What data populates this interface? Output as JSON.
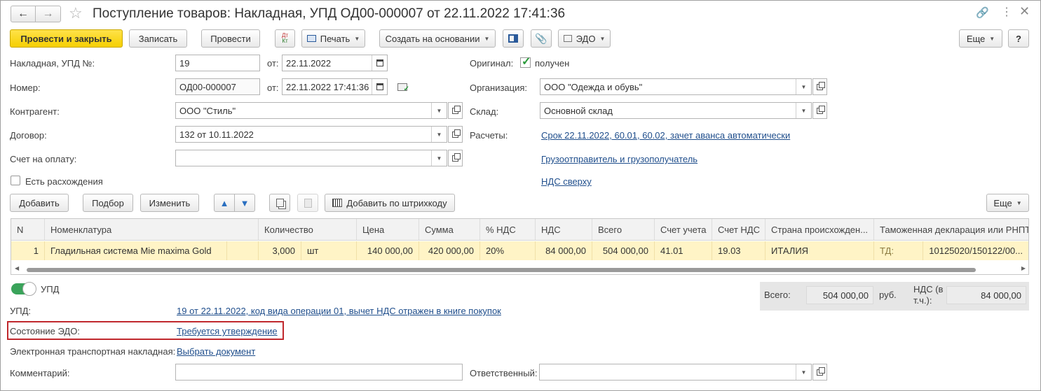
{
  "window": {
    "title": "Поступление товаров: Накладная, УПД ОД00-000007 от 22.11.2022 17:41:36"
  },
  "toolbar": {
    "post_close": "Провести и закрыть",
    "save": "Записать",
    "post": "Провести",
    "dt_kt": "Дт Кт",
    "print": "Печать",
    "create_based": "Создать на основании",
    "edo": "ЭДО",
    "more": "Еще",
    "help": "?"
  },
  "form": {
    "invoice_label": "Накладная, УПД №:",
    "invoice_value": "19",
    "from_label": "от:",
    "invoice_date": "22.11.2022",
    "number_label": "Номер:",
    "number_value": "ОД00-000007",
    "number_date": "22.11.2022 17:41:36",
    "counterparty_label": "Контрагент:",
    "counterparty_value": "ООО \"Стиль\"",
    "contract_label": "Договор:",
    "contract_value": "132 от 10.11.2022",
    "payment_label": "Счет на оплату:",
    "payment_value": "",
    "discrepancy_label": "Есть расхождения",
    "original_label": "Оригинал:",
    "received_label": "получен",
    "org_label": "Организация:",
    "org_value": "ООО \"Одежда и обувь\"",
    "warehouse_label": "Склад:",
    "warehouse_value": "Основной склад",
    "settlements_label": "Расчеты:",
    "settlements_link": "Срок 22.11.2022, 60.01, 60.02, зачет аванса автоматически",
    "shipper_link": "Грузоотправитель и грузополучатель",
    "vat_link": "НДС сверху"
  },
  "table_toolbar": {
    "add": "Добавить",
    "pick": "Подбор",
    "edit": "Изменить",
    "barcode": "Добавить по штрихкоду",
    "more": "Еще"
  },
  "table": {
    "headers": [
      "N",
      "Номенклатура",
      "Количество",
      "Цена",
      "Сумма",
      "% НДС",
      "НДС",
      "Всего",
      "Счет учета",
      "Счет НДС",
      "Страна происхожден...",
      "Таможенная декларация или РНПТ"
    ],
    "row": {
      "n": "1",
      "item": "Гладильная система Mie maxima Gold",
      "qty": "3,000",
      "unit": "шт",
      "price": "140 000,00",
      "sum": "420 000,00",
      "vat_rate": "20%",
      "vat": "84 000,00",
      "total": "504 000,00",
      "account": "41.01",
      "vat_account": "19.03",
      "country": "ИТАЛИЯ",
      "decl_type": "ТД:",
      "decl": "10125020/150122/00..."
    }
  },
  "bottom": {
    "upd_toggle": "УПД",
    "upd_label": "УПД:",
    "upd_link": "19 от 22.11.2022, код вида операции 01, вычет НДС отражен в книге покупок",
    "edo_state_label": "Состояние ЭДО:",
    "edo_state_link": "Требуется утверждение",
    "ettn_label": "Электронная транспортная накладная:",
    "ettn_link": "Выбрать документ",
    "comment_label": "Комментарий:",
    "comment_value": "",
    "responsible_label": "Ответственный:",
    "responsible_value": ""
  },
  "totals": {
    "total_label": "Всего:",
    "total_value": "504 000,00",
    "currency": "руб.",
    "vat_label_1": "НДС (в",
    "vat_label_2": "т.ч.):",
    "vat_value": "84 000,00"
  },
  "colors": {
    "accent_yellow": "#f5cf00",
    "link": "#1f4e8c",
    "highlight_border": "#c0282d",
    "toggle_green": "#3aa35a",
    "selected_row": "#fff4c6"
  }
}
